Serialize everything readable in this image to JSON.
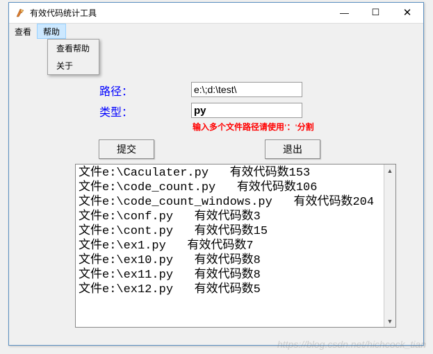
{
  "window": {
    "title": "有效代码统计工具"
  },
  "menu": {
    "view": "查看",
    "help": "帮助",
    "help_items": {
      "view_help": "查看帮助",
      "about": "关于"
    }
  },
  "form": {
    "path_label": "路径：",
    "path_value": "e:\\;d:\\test\\",
    "type_label": "类型：",
    "type_value": "py",
    "hint": "输入多个文件路径请使用'：'分割"
  },
  "buttons": {
    "submit": "提交",
    "exit": "退出"
  },
  "output_lines": [
    "文件e:\\Caculater.py   有效代码数153",
    "文件e:\\code_count.py   有效代码数106",
    "文件e:\\code_count_windows.py   有效代码数204",
    "文件e:\\conf.py   有效代码数3",
    "文件e:\\cont.py   有效代码数15",
    "文件e:\\ex1.py   有效代码数7",
    "文件e:\\ex10.py   有效代码数8",
    "文件e:\\ex11.py   有效代码数8",
    "文件e:\\ex12.py   有效代码数5"
  ],
  "watermark": "https://blog.csdn.net/hichcock_tian"
}
